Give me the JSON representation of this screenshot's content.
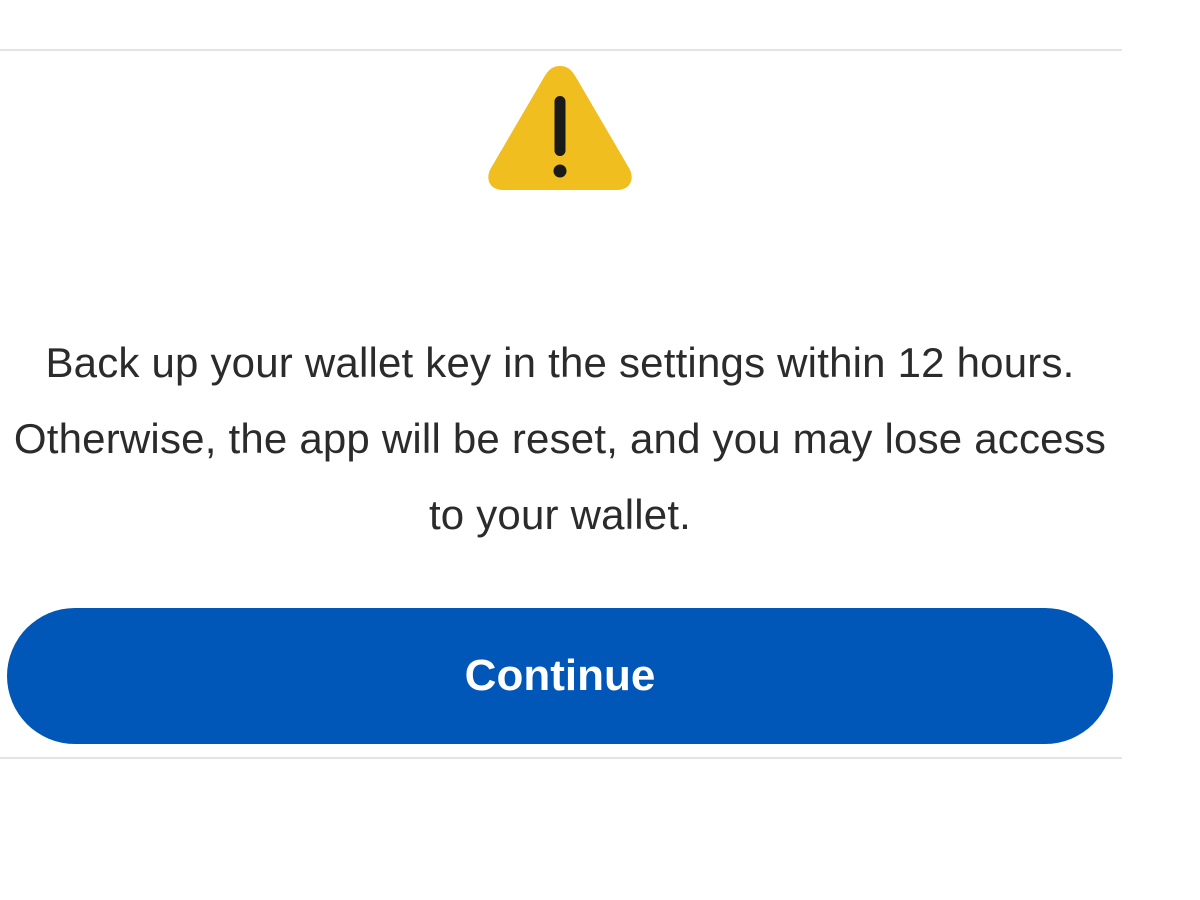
{
  "dialog": {
    "icon": "warning-icon",
    "icon_color": "#F0BE1E",
    "message": "Back up your wallet key in the settings within 12 hours. Otherwise, the app will be reset, and you may lose access to your wallet.",
    "continue_label": "Continue",
    "button_color": "#0057B8"
  }
}
